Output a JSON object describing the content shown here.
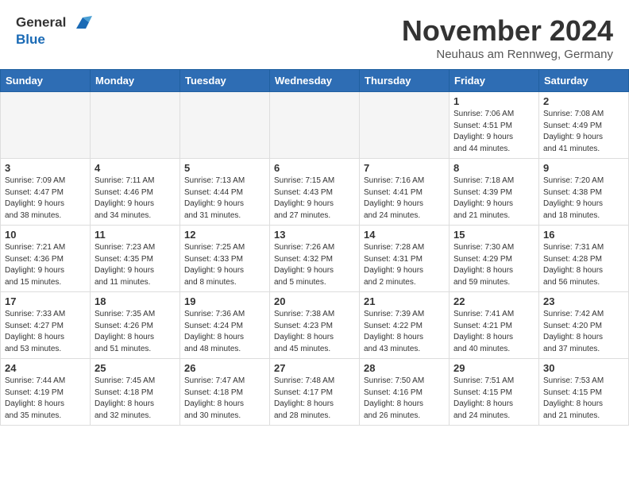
{
  "header": {
    "logo_line1": "General",
    "logo_line2": "Blue",
    "month_title": "November 2024",
    "location": "Neuhaus am Rennweg, Germany"
  },
  "weekdays": [
    "Sunday",
    "Monday",
    "Tuesday",
    "Wednesday",
    "Thursday",
    "Friday",
    "Saturday"
  ],
  "weeks": [
    [
      {
        "day": "",
        "info": ""
      },
      {
        "day": "",
        "info": ""
      },
      {
        "day": "",
        "info": ""
      },
      {
        "day": "",
        "info": ""
      },
      {
        "day": "",
        "info": ""
      },
      {
        "day": "1",
        "info": "Sunrise: 7:06 AM\nSunset: 4:51 PM\nDaylight: 9 hours\nand 44 minutes."
      },
      {
        "day": "2",
        "info": "Sunrise: 7:08 AM\nSunset: 4:49 PM\nDaylight: 9 hours\nand 41 minutes."
      }
    ],
    [
      {
        "day": "3",
        "info": "Sunrise: 7:09 AM\nSunset: 4:47 PM\nDaylight: 9 hours\nand 38 minutes."
      },
      {
        "day": "4",
        "info": "Sunrise: 7:11 AM\nSunset: 4:46 PM\nDaylight: 9 hours\nand 34 minutes."
      },
      {
        "day": "5",
        "info": "Sunrise: 7:13 AM\nSunset: 4:44 PM\nDaylight: 9 hours\nand 31 minutes."
      },
      {
        "day": "6",
        "info": "Sunrise: 7:15 AM\nSunset: 4:43 PM\nDaylight: 9 hours\nand 27 minutes."
      },
      {
        "day": "7",
        "info": "Sunrise: 7:16 AM\nSunset: 4:41 PM\nDaylight: 9 hours\nand 24 minutes."
      },
      {
        "day": "8",
        "info": "Sunrise: 7:18 AM\nSunset: 4:39 PM\nDaylight: 9 hours\nand 21 minutes."
      },
      {
        "day": "9",
        "info": "Sunrise: 7:20 AM\nSunset: 4:38 PM\nDaylight: 9 hours\nand 18 minutes."
      }
    ],
    [
      {
        "day": "10",
        "info": "Sunrise: 7:21 AM\nSunset: 4:36 PM\nDaylight: 9 hours\nand 15 minutes."
      },
      {
        "day": "11",
        "info": "Sunrise: 7:23 AM\nSunset: 4:35 PM\nDaylight: 9 hours\nand 11 minutes."
      },
      {
        "day": "12",
        "info": "Sunrise: 7:25 AM\nSunset: 4:33 PM\nDaylight: 9 hours\nand 8 minutes."
      },
      {
        "day": "13",
        "info": "Sunrise: 7:26 AM\nSunset: 4:32 PM\nDaylight: 9 hours\nand 5 minutes."
      },
      {
        "day": "14",
        "info": "Sunrise: 7:28 AM\nSunset: 4:31 PM\nDaylight: 9 hours\nand 2 minutes."
      },
      {
        "day": "15",
        "info": "Sunrise: 7:30 AM\nSunset: 4:29 PM\nDaylight: 8 hours\nand 59 minutes."
      },
      {
        "day": "16",
        "info": "Sunrise: 7:31 AM\nSunset: 4:28 PM\nDaylight: 8 hours\nand 56 minutes."
      }
    ],
    [
      {
        "day": "17",
        "info": "Sunrise: 7:33 AM\nSunset: 4:27 PM\nDaylight: 8 hours\nand 53 minutes."
      },
      {
        "day": "18",
        "info": "Sunrise: 7:35 AM\nSunset: 4:26 PM\nDaylight: 8 hours\nand 51 minutes."
      },
      {
        "day": "19",
        "info": "Sunrise: 7:36 AM\nSunset: 4:24 PM\nDaylight: 8 hours\nand 48 minutes."
      },
      {
        "day": "20",
        "info": "Sunrise: 7:38 AM\nSunset: 4:23 PM\nDaylight: 8 hours\nand 45 minutes."
      },
      {
        "day": "21",
        "info": "Sunrise: 7:39 AM\nSunset: 4:22 PM\nDaylight: 8 hours\nand 43 minutes."
      },
      {
        "day": "22",
        "info": "Sunrise: 7:41 AM\nSunset: 4:21 PM\nDaylight: 8 hours\nand 40 minutes."
      },
      {
        "day": "23",
        "info": "Sunrise: 7:42 AM\nSunset: 4:20 PM\nDaylight: 8 hours\nand 37 minutes."
      }
    ],
    [
      {
        "day": "24",
        "info": "Sunrise: 7:44 AM\nSunset: 4:19 PM\nDaylight: 8 hours\nand 35 minutes."
      },
      {
        "day": "25",
        "info": "Sunrise: 7:45 AM\nSunset: 4:18 PM\nDaylight: 8 hours\nand 32 minutes."
      },
      {
        "day": "26",
        "info": "Sunrise: 7:47 AM\nSunset: 4:18 PM\nDaylight: 8 hours\nand 30 minutes."
      },
      {
        "day": "27",
        "info": "Sunrise: 7:48 AM\nSunset: 4:17 PM\nDaylight: 8 hours\nand 28 minutes."
      },
      {
        "day": "28",
        "info": "Sunrise: 7:50 AM\nSunset: 4:16 PM\nDaylight: 8 hours\nand 26 minutes."
      },
      {
        "day": "29",
        "info": "Sunrise: 7:51 AM\nSunset: 4:15 PM\nDaylight: 8 hours\nand 24 minutes."
      },
      {
        "day": "30",
        "info": "Sunrise: 7:53 AM\nSunset: 4:15 PM\nDaylight: 8 hours\nand 21 minutes."
      }
    ]
  ]
}
